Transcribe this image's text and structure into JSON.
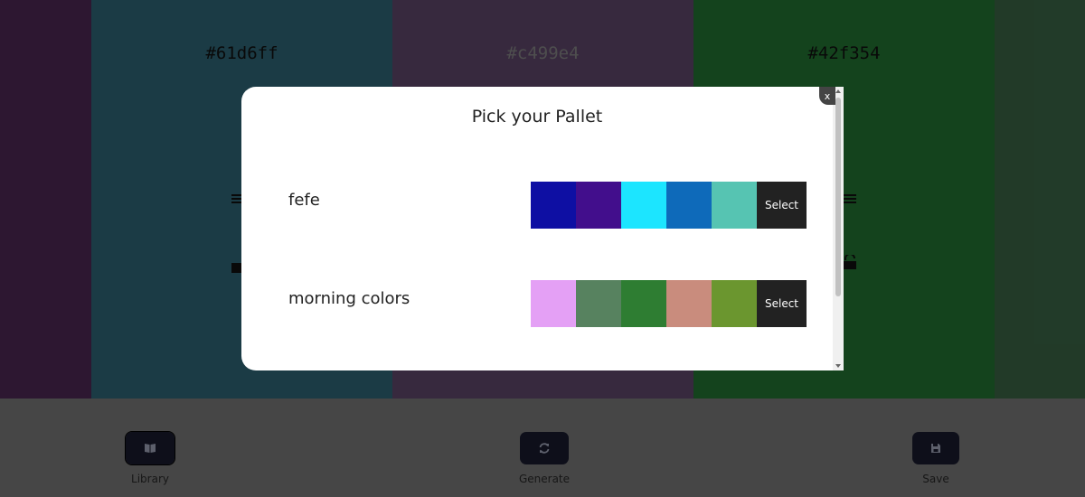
{
  "columns": [
    {
      "color": "#522a5a"
    },
    {
      "hex": "#61d6ff",
      "color": "#326c7e",
      "text_color": "#111111"
    },
    {
      "hex": "#c499e4",
      "color": "#644c72",
      "text_color": "#8e8e8e"
    },
    {
      "hex": "#42f354",
      "color": "#267a35",
      "text_color": "#111111"
    },
    {
      "color": "#3e6b4a"
    }
  ],
  "panel": {
    "library_label": "Library",
    "generate_label": "Generate",
    "save_label": "Save"
  },
  "modal": {
    "title": "Pick your Pallet",
    "close_label": "x",
    "palettes": [
      {
        "name": "fefe",
        "select_label": "Select",
        "colors": [
          "#0e0fa3",
          "#420e8c",
          "#1ce5ff",
          "#0e6aba",
          "#56c4b2"
        ]
      },
      {
        "name": "morning colors",
        "select_label": "Select",
        "colors": [
          "#e4a0f5",
          "#57825f",
          "#2e7d32",
          "#c98c7d",
          "#6b962f"
        ]
      }
    ]
  }
}
